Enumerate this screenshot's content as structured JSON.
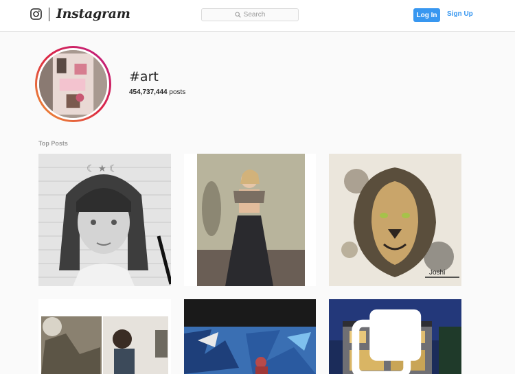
{
  "header": {
    "logo_icon": "instagram-camera-icon",
    "wordmark": "Instagram",
    "search_placeholder": "Search",
    "login_label": "Log In",
    "signup_label": "Sign Up",
    "accent_color": "#3897f0"
  },
  "hashtag": {
    "title": "#art",
    "post_count": "454,737,444",
    "post_suffix": "posts"
  },
  "top_posts": {
    "label": "Top Posts",
    "tiles": [
      {
        "subject": "pencil drawing of girl with bangs"
      },
      {
        "subject": "woman posing in dark skirt"
      },
      {
        "subject": "painted lion portrait"
      },
      {
        "subject": "two-panel photo with man"
      },
      {
        "subject": "graffiti wall scene"
      },
      {
        "subject": "modern house at dusk",
        "icon": "multiple-images-icon"
      }
    ]
  }
}
